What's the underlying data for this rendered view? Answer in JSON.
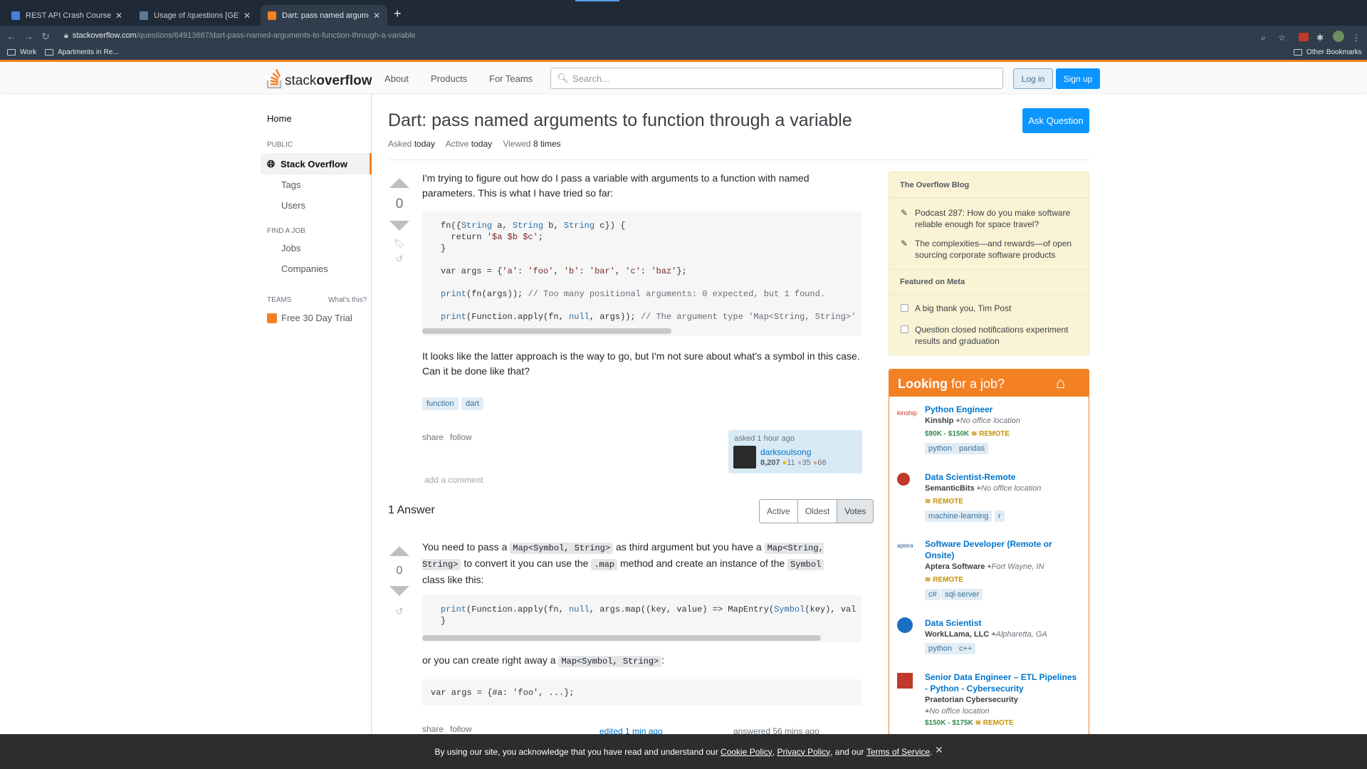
{
  "browser": {
    "tabs": [
      {
        "title": "REST API Crash Course - Con",
        "active": false
      },
      {
        "title": "Usage of /questions [GET] - S",
        "active": false
      },
      {
        "title": "Dart: pass named arguments t",
        "active": true
      }
    ],
    "url_host": "stackoverflow.com",
    "url_path": "/questions/64913687/dart-pass-named-arguments-to-function-through-a-variable",
    "bookmarks": [
      "Work",
      "Apartments in Re..."
    ],
    "other_bookmarks": "Other Bookmarks"
  },
  "header": {
    "logo_stack": "stack",
    "logo_overflow": "overflow",
    "nav": [
      "About",
      "Products",
      "For Teams"
    ],
    "search_placeholder": "Search...",
    "login": "Log in",
    "signup": "Sign up"
  },
  "sidebar": {
    "home": "Home",
    "public_heading": "PUBLIC",
    "stack_overflow": "Stack Overflow",
    "tags": "Tags",
    "users": "Users",
    "find_job_heading": "FIND A JOB",
    "jobs": "Jobs",
    "companies": "Companies",
    "teams_heading": "TEAMS",
    "whats_this": "What's this?",
    "free_trial": "Free 30 Day Trial"
  },
  "question": {
    "title": "Dart: pass named arguments to function through a variable",
    "asked_label": "Asked",
    "asked_value": "today",
    "active_label": "Active",
    "active_value": "today",
    "viewed_label": "Viewed",
    "viewed_value": "8 times",
    "ask_button": "Ask Question",
    "votes": "0",
    "body_1": "I'm trying to figure out how do I pass a variable with arguments to a function with named parameters. This is what I have tried so far:",
    "body_2": "It looks like the latter approach is the way to go, but I'm not sure about what's a symbol in this case. Can it be done like that?",
    "tags": [
      "function",
      "dart"
    ],
    "share": "share",
    "follow": "follow",
    "add_comment": "add a comment",
    "owner": {
      "asked": "asked 1 hour ago",
      "name": "darksoulsong",
      "rep": "8,207",
      "gold": "11",
      "silver": "35",
      "bronze": "66"
    }
  },
  "answers": {
    "heading": "1 Answer",
    "sort_tabs": [
      "Active",
      "Oldest",
      "Votes"
    ],
    "votes": "0",
    "text_1": "You need to pass a",
    "code_1": "Map<Symbol, String>",
    "text_2": "as third argument but you have a",
    "code_2": "Map<String, String>",
    "text_3": "to convert it you can use the",
    "code_3": ".map",
    "text_4": "method and create an instance of the",
    "code_4": "Symbol",
    "text_5": "class like this:",
    "text_6": "or you can create right away a",
    "code_6": "Map<Symbol, String>",
    "text_6b": ":",
    "code_line": "var args = {#a: 'foo', ...};",
    "share": "share",
    "follow": "follow",
    "edited": "edited 1 min ago",
    "answered": "answered 56 mins ago"
  },
  "blog": {
    "heading": "The Overflow Blog",
    "items": [
      "Podcast 287: How do you make software reliable enough for space travel?",
      "The complexities—and rewards—of open sourcing corporate software products"
    ],
    "meta_heading": "Featured on Meta",
    "meta_items": [
      "A big thank you, Tim Post",
      "Question closed notifications experiment results and graduation"
    ]
  },
  "jobs": {
    "heading_bold": "Looking",
    "heading_rest": "for a job?",
    "list": [
      {
        "title": "Python Engineer",
        "company": "Kinship",
        "location": "No office location",
        "salary": "$90K - $150K",
        "remote": "REMOTE",
        "tags": [
          "python",
          "pandas"
        ],
        "logo_text": "kinship"
      },
      {
        "title": "Data Scientist-Remote",
        "company": "SemanticBits",
        "location": "No office location",
        "remote": "REMOTE",
        "tags": [
          "machine-learning",
          "r"
        ]
      },
      {
        "title": "Software Developer (Remote or Onsite)",
        "company": "Aptera Software",
        "location": "Fort Wayne, IN",
        "remote": "REMOTE",
        "tags": [
          "c#",
          "sql-server"
        ],
        "logo_text": "aptera"
      },
      {
        "title": "Data Scientist",
        "company": "WorkLLama, LLC",
        "location": "Alpharetta, GA",
        "tags": [
          "python",
          "c++"
        ]
      },
      {
        "title": "Senior Data Engineer – ETL Pipelines - Python - Cybersecurity",
        "company": "Praetorian Cybersecurity",
        "location": "No office location",
        "salary": "$150K - $175K",
        "remote": "REMOTE"
      }
    ]
  },
  "cookie": {
    "text_1": "By using our site, you acknowledge that you have read and understand our",
    "cookie_policy": "Cookie Policy",
    "sep": ",",
    "privacy_policy": "Privacy Policy",
    "and_our": ", and our",
    "terms": "Terms of Service",
    "end": "."
  },
  "colors": {
    "accent": "#f48024",
    "link": "#0074cc",
    "button": "#0a95ff"
  }
}
